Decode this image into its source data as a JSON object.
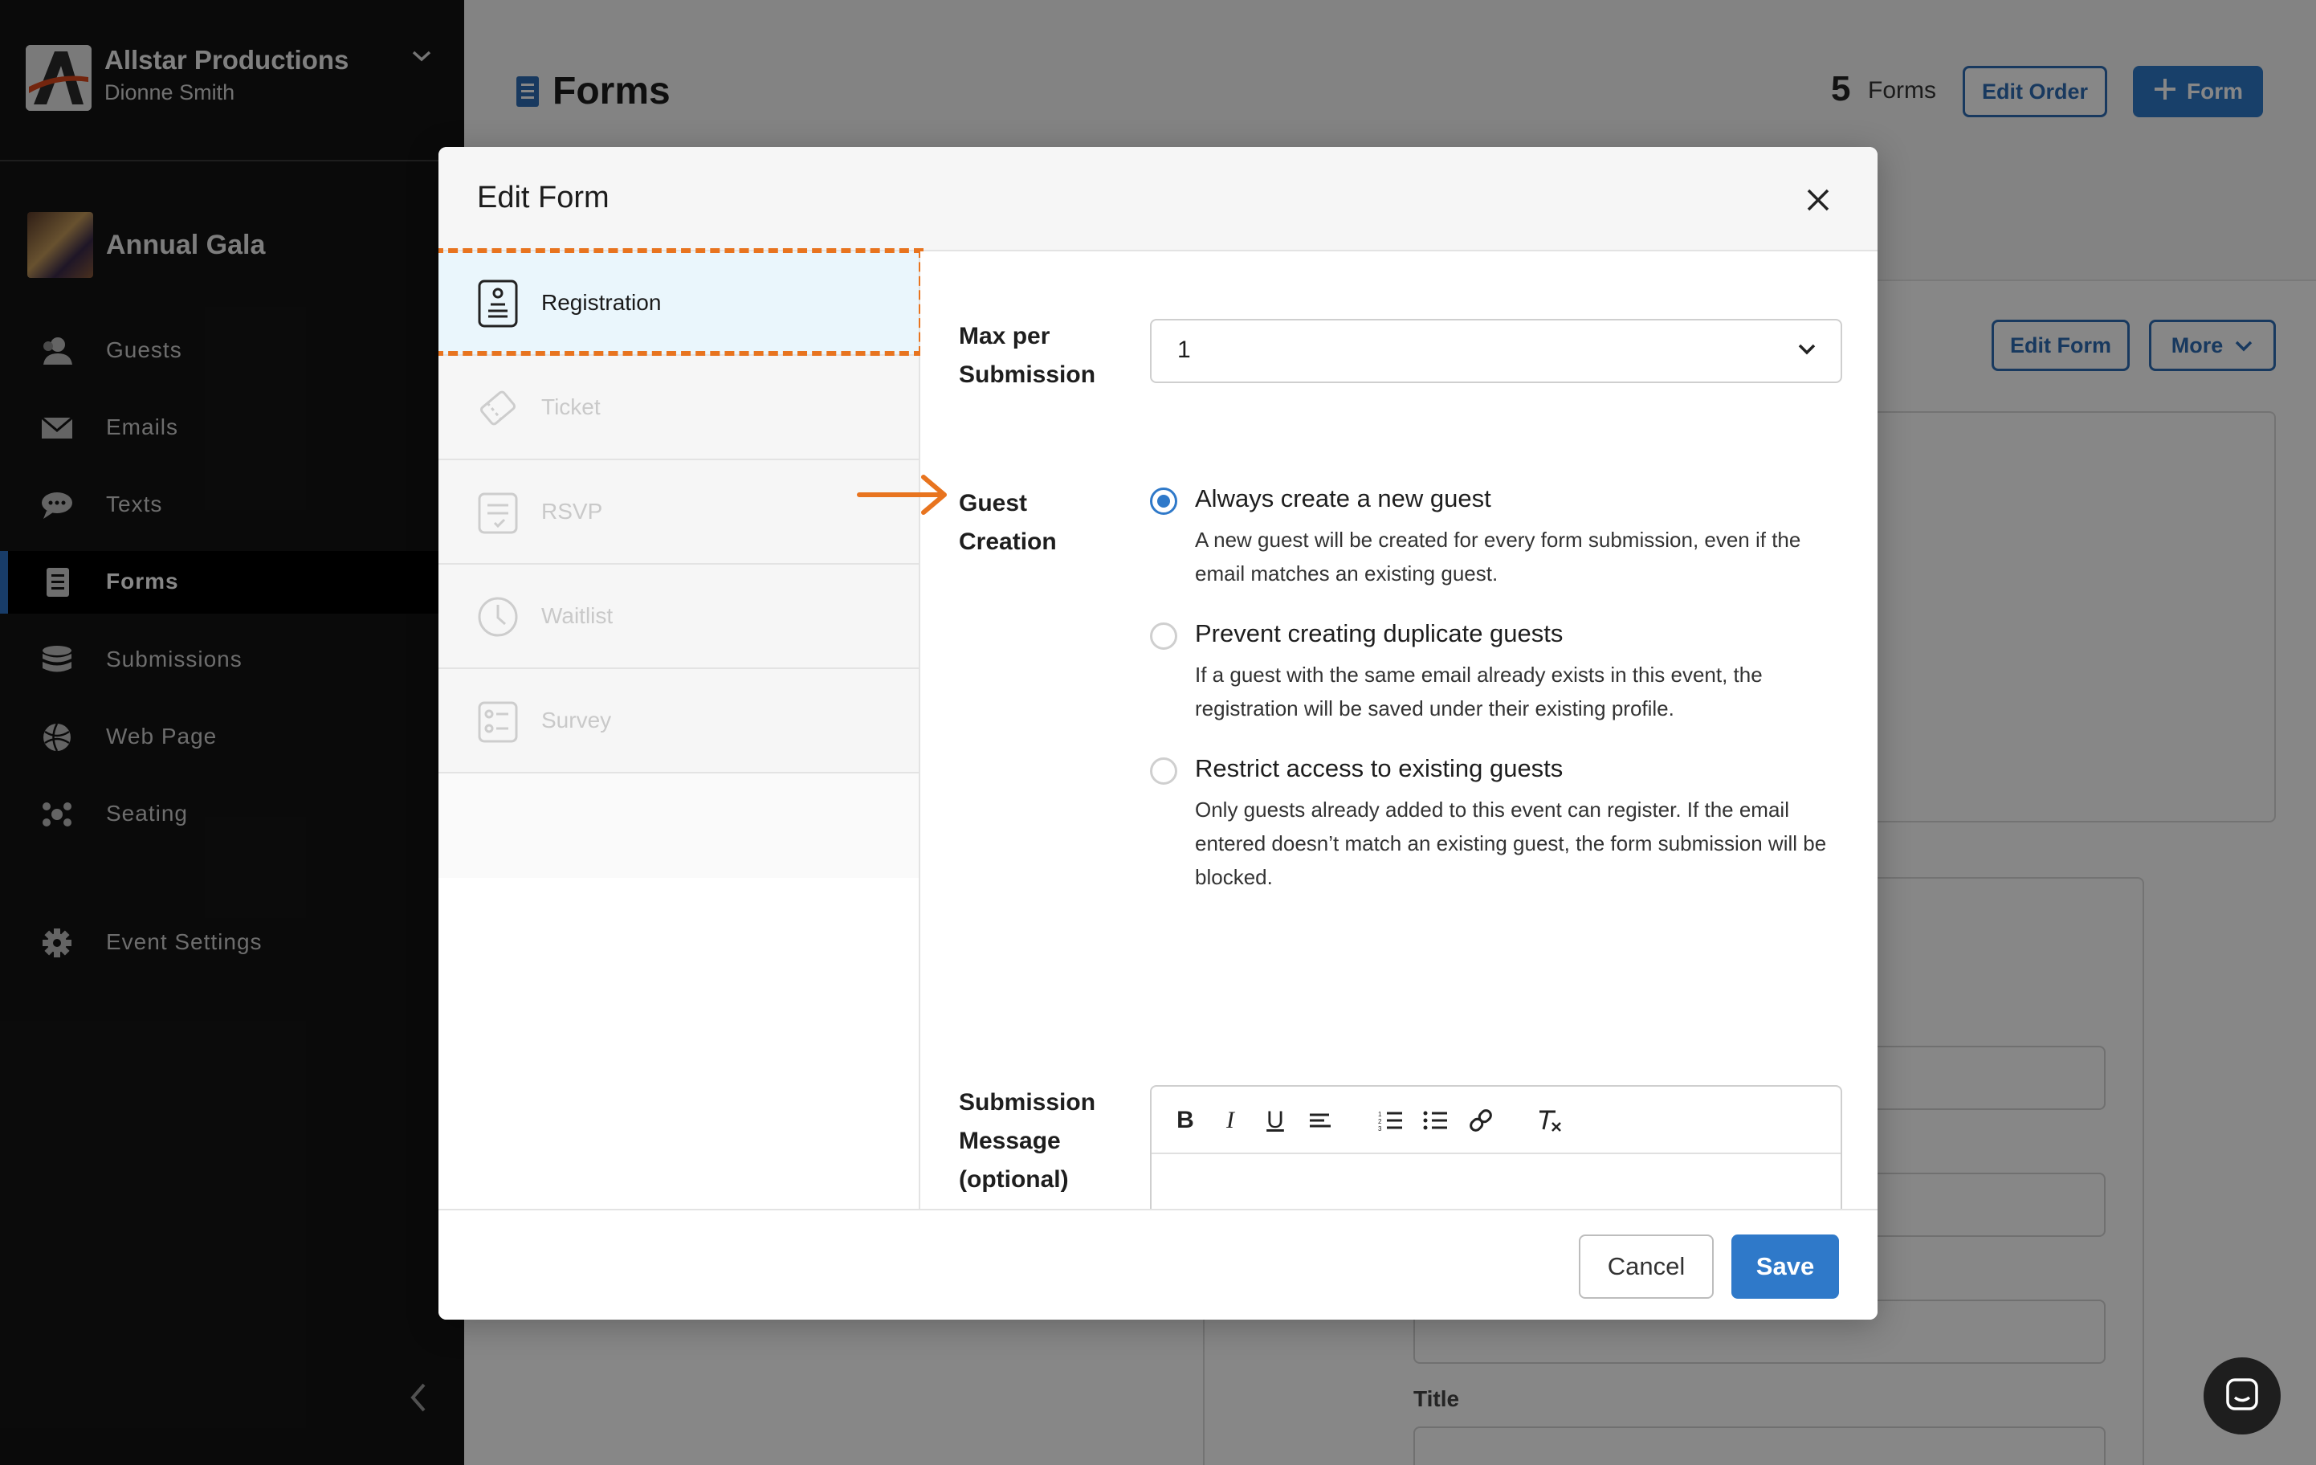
{
  "org": {
    "name": "Allstar Productions",
    "user": "Dionne Smith"
  },
  "event": {
    "name": "Annual Gala"
  },
  "sidebar": {
    "items": [
      {
        "label": "Guests",
        "icon": "guests-icon"
      },
      {
        "label": "Emails",
        "icon": "envelope-icon"
      },
      {
        "label": "Texts",
        "icon": "chat-bubble-icon"
      },
      {
        "label": "Forms",
        "icon": "form-icon",
        "active": true
      },
      {
        "label": "Submissions",
        "icon": "database-icon"
      },
      {
        "label": "Web Page",
        "icon": "globe-icon"
      },
      {
        "label": "Seating",
        "icon": "seating-icon"
      },
      {
        "label": "Event Settings",
        "icon": "gear-icon"
      }
    ]
  },
  "header": {
    "title": "Forms",
    "count": "5",
    "count_label": "Forms",
    "edit_order_label": "Edit Order",
    "add_form_label": "Form",
    "edit_form_label": "Edit Form",
    "more_label": "More"
  },
  "background": {
    "field_title": "Title"
  },
  "modal": {
    "title": "Edit Form",
    "tabs": [
      {
        "label": "Registration",
        "selected": true
      },
      {
        "label": "Ticket"
      },
      {
        "label": "RSVP"
      },
      {
        "label": "Waitlist"
      },
      {
        "label": "Survey"
      }
    ],
    "max_per_submission": {
      "label_line1": "Max per",
      "label_line2": "Submission",
      "value": "1"
    },
    "guest_creation": {
      "label_line1": "Guest",
      "label_line2": "Creation",
      "options": [
        {
          "title": "Always create a new guest",
          "description": "A new guest will be created for every form submission, even if the email matches an existing guest.",
          "selected": true
        },
        {
          "title": "Prevent creating duplicate guests",
          "description": "If a guest with the same email already exists in this event, the registration will be saved under their existing profile.",
          "selected": false
        },
        {
          "title": "Restrict access to existing guests",
          "description": "Only guests already added to this event can register. If the email entered doesn’t match an existing guest, the form submission will be blocked.",
          "selected": false
        }
      ]
    },
    "submission_message": {
      "label_line1": "Submission",
      "label_line2": "Message",
      "label_line3": "(optional)",
      "value": ""
    },
    "toolbar": {
      "bold": "B",
      "italic": "I",
      "underline": "U"
    },
    "cancel_label": "Cancel",
    "save_label": "Save"
  },
  "colors": {
    "accent": "#2f79c9",
    "highlight": "#e8741f",
    "sidebar_bg": "#141414"
  }
}
